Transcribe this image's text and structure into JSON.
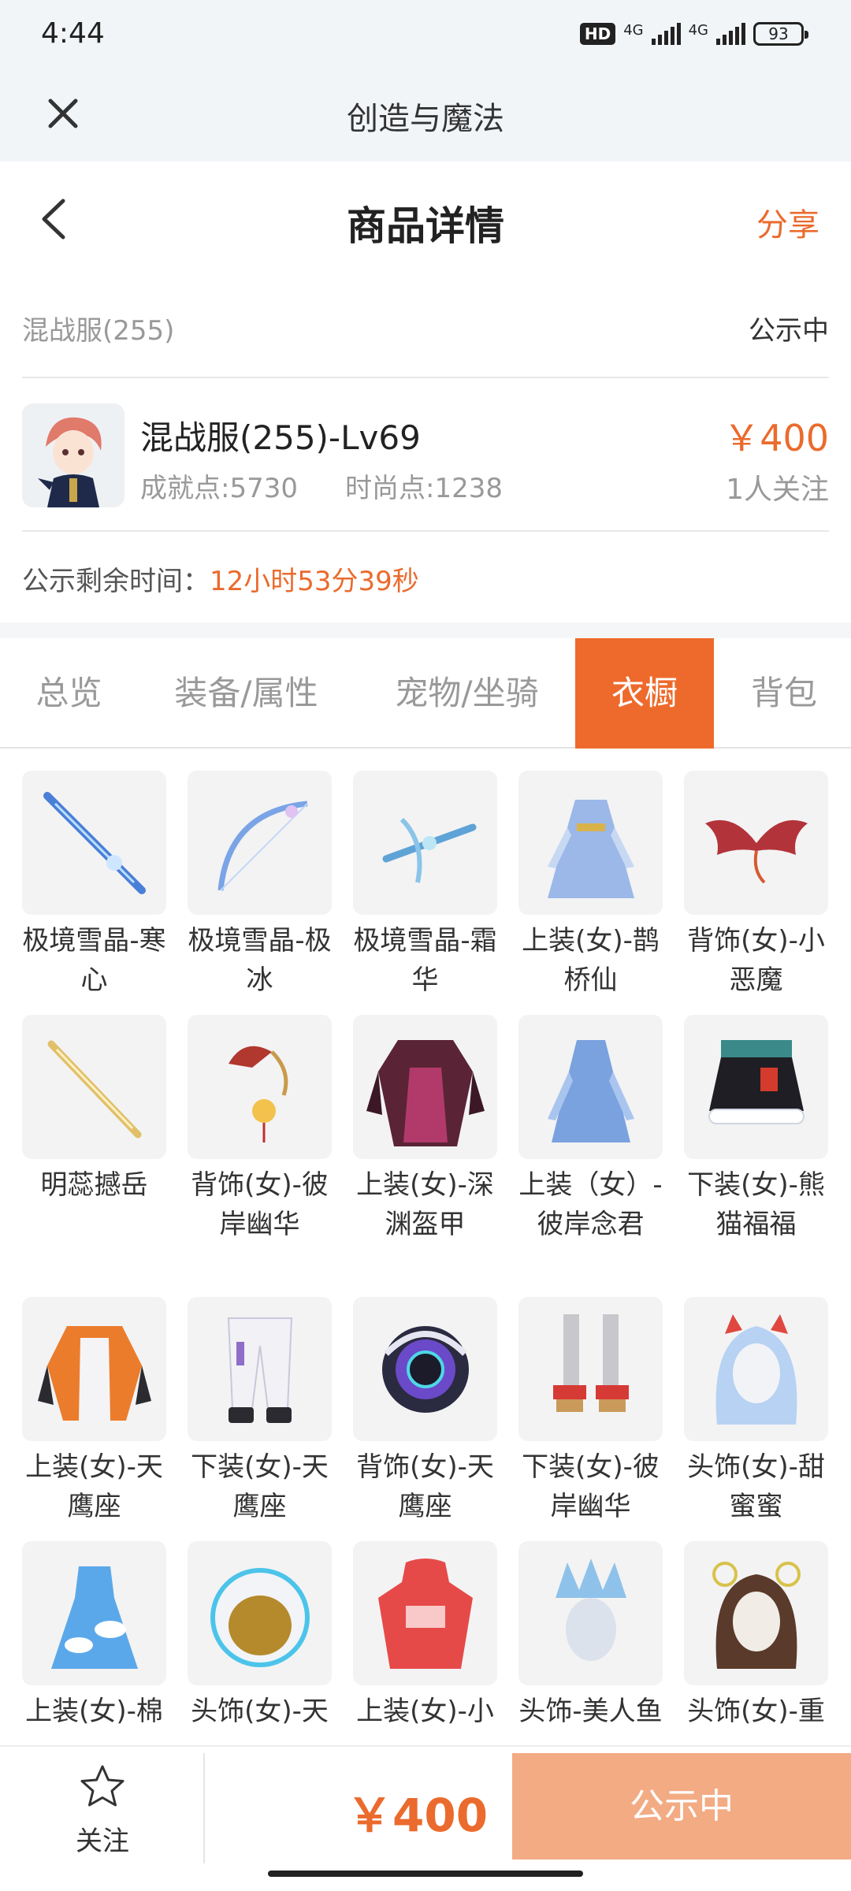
{
  "status_bar": {
    "time": "4:44",
    "hd": "HD",
    "net1": "4G",
    "net2": "4G",
    "battery": "93"
  },
  "app_bar": {
    "title": "创造与魔法"
  },
  "header": {
    "title": "商品详情",
    "share": "分享"
  },
  "product": {
    "server": "混战服(255)",
    "status": "公示中",
    "name": "混战服(255)-Lv69",
    "achievement": "成就点:5730",
    "fashion": "时尚点:1238",
    "price": "￥400",
    "followers": "1人关注",
    "remaining_label": "公示剩余时间：",
    "remaining_time": "12小时53分39秒"
  },
  "tabs": [
    {
      "label": "总览"
    },
    {
      "label": "装备/属性"
    },
    {
      "label": "宠物/坐骑"
    },
    {
      "label": "衣橱",
      "active": true
    },
    {
      "label": "背包"
    }
  ],
  "items": [
    {
      "name": "极境雪晶-寒心",
      "icon": "sword-icon"
    },
    {
      "name": "极境雪晶-极冰",
      "icon": "bow-icon"
    },
    {
      "name": "极境雪晶-霜华",
      "icon": "crossbow-icon"
    },
    {
      "name": "上装(女)-鹊桥仙",
      "icon": "dress-icon"
    },
    {
      "name": "背饰(女)-小恶魔",
      "icon": "wings-icon"
    },
    {
      "name": "明蕊撼岳",
      "icon": "sword-icon"
    },
    {
      "name": "背饰(女)-彼岸幽华",
      "icon": "fan-ornament-icon"
    },
    {
      "name": "上装(女)-深渊盔甲",
      "icon": "armor-icon"
    },
    {
      "name": "上装（女）-彼岸念君",
      "icon": "dress-icon"
    },
    {
      "name": "下装(女)-熊猫福福",
      "icon": "skirt-icon"
    },
    {
      "name": "上装(女)-天鹰座",
      "icon": "jacket-icon"
    },
    {
      "name": "下装(女)-天鹰座",
      "icon": "pants-icon"
    },
    {
      "name": "背饰(女)-天鹰座",
      "icon": "backpack-icon"
    },
    {
      "name": "下装(女)-彼岸幽华",
      "icon": "shoes-icon"
    },
    {
      "name": "头饰(女)-甜蜜蜜",
      "icon": "hair-icon"
    },
    {
      "name": "上装(女)-棉花糖",
      "icon": "dress-icon"
    },
    {
      "name": "头饰(女)-天鹰座",
      "icon": "helmet-icon"
    },
    {
      "name": "上装(女)-小帽哥",
      "icon": "hoodie-icon"
    },
    {
      "name": "头饰-美人鱼之冠",
      "icon": "crown-icon"
    },
    {
      "name": "头饰(女)-重午",
      "icon": "hair-icon"
    }
  ],
  "colors": {
    "accent": "#ee6a2c",
    "price": "#ea6b2d",
    "disabled_button": "#f3ab84"
  },
  "bottom_bar": {
    "follow": "关注",
    "price": "￥400",
    "button": "公示中"
  }
}
